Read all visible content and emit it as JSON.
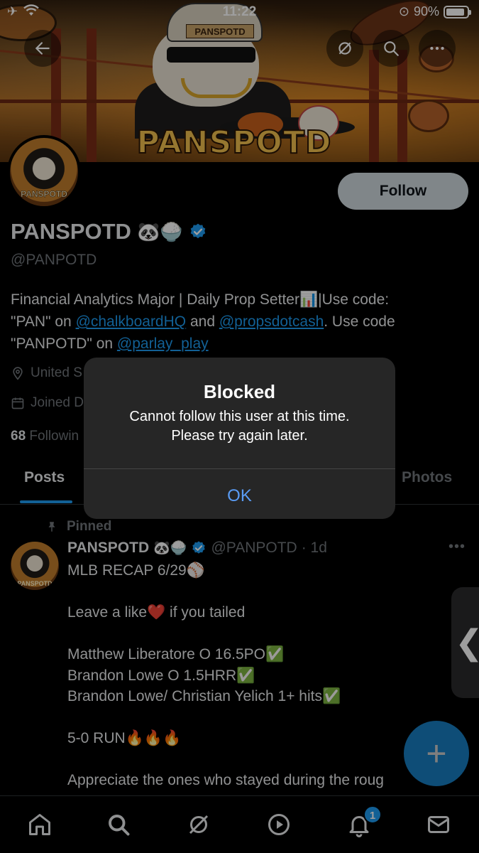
{
  "status_bar": {
    "time": "11:22",
    "battery": "90%",
    "battery_level": 0.9
  },
  "banner": {
    "hat_text": "PANSPOTD",
    "wordmark": "PANSPOTD"
  },
  "profile": {
    "avatar_text": "PANSPOTD",
    "follow_label": "Follow",
    "display_name": "PANSPOTD",
    "name_emojis": "🐼🍚",
    "handle": "@PANPOTD",
    "bio": {
      "line1_text": "Financial Analytics Major | Daily Prop Setter",
      "line1_emoji": "📊",
      "line1_tail": "|Use code:",
      "line2_a": "\"PAN\" on ",
      "link1": "@chalkboardHQ",
      "line2_b": " and ",
      "link2": "@propsdotcash",
      "line2_c": ". Use code",
      "line3_a": "\"PANPOTD\" on ",
      "link3": "@parlay_play"
    },
    "location": "United S",
    "joined": "Joined D",
    "following_count": "68",
    "following_label": "Followin"
  },
  "tabs": {
    "posts": "Posts",
    "photos": "Photos"
  },
  "post": {
    "pinned_label": "Pinned",
    "avatar_text": "PANSPOTD",
    "author_name": "PANSPOTD",
    "author_emojis": "🐼🍚",
    "author_handle": "@PANPOTD",
    "time": "· 1d",
    "more": "•••",
    "body": "MLB RECAP 6/29⚾\n\nLeave a like❤️ if you tailed\n\nMatthew Liberatore O 16.5PO✅\nBrandon Lowe O 1.5HRR✅\nBrandon Lowe/ Christian Yelich 1+ hits✅\n\n5-0 RUN🔥🔥🔥\n\nAppreciate the ones who stayed during the roug"
  },
  "side_tab": {
    "glyph": "❮"
  },
  "fab": {
    "glyph": "+"
  },
  "nav": {
    "notifications_badge": "1"
  },
  "dialog": {
    "title": "Blocked",
    "message_line1": "Cannot follow this user at this time.",
    "message_line2": "Please try again later.",
    "ok_label": "OK"
  }
}
